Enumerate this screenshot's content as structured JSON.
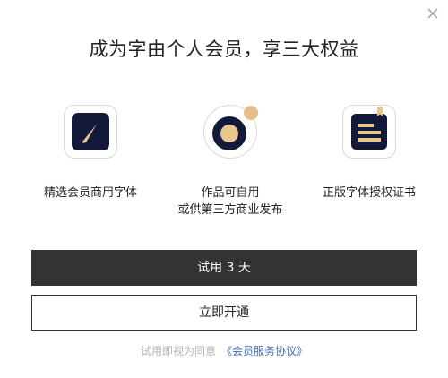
{
  "dialog": {
    "title": "成为字由个人会员，享三大权益",
    "close_icon": "close-icon"
  },
  "features": [
    {
      "icon": "pen-nib-icon",
      "lines": [
        "精选会员商用字体"
      ]
    },
    {
      "icon": "works-badge-icon",
      "lines": [
        "作品可自用",
        "或供第三方商业发布"
      ]
    },
    {
      "icon": "certificate-icon",
      "lines": [
        "正版字体授权证书"
      ]
    }
  ],
  "buttons": {
    "trial_label": "试用 3 天",
    "open_label": "立即开通"
  },
  "agreement": {
    "prefix": "试用即视为同意",
    "link_text": "《会员服务协议》"
  },
  "colors": {
    "primary_dark": "#333333",
    "icon_navy": "#12193a",
    "icon_gold": "#e9c68c",
    "link_blue": "#3f6fb6",
    "muted_text": "#b5b5b5"
  }
}
